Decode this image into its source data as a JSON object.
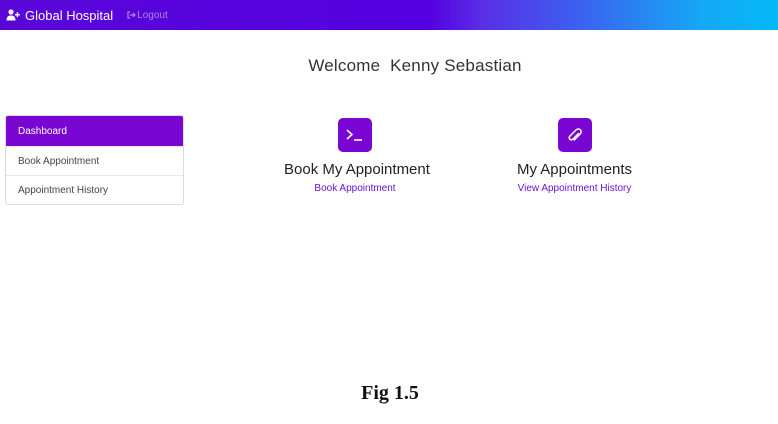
{
  "navbar": {
    "brand": "Global Hospital",
    "brand_icon": "user-plus-icon",
    "logout": "Logout",
    "logout_icon": "sign-out-icon"
  },
  "welcome": {
    "text": "Welcome  Kenny Sebastian"
  },
  "sidebar": {
    "items": [
      {
        "label": "Dashboard",
        "active": true
      },
      {
        "label": "Book Appointment",
        "active": false
      },
      {
        "label": "Appointment History",
        "active": false
      }
    ]
  },
  "cards": [
    {
      "icon": "terminal-icon",
      "title": "Book My Appointment",
      "link": "Book Appointment"
    },
    {
      "icon": "paperclip-icon",
      "title": "My Appointments",
      "link": "View Appointment History"
    }
  ],
  "caption": "Fig 1.5",
  "colors": {
    "accent": "#7a06d4",
    "link": "#6d10d6",
    "navbar_start": "#5a05d8",
    "navbar_end": "#05b8f7"
  }
}
